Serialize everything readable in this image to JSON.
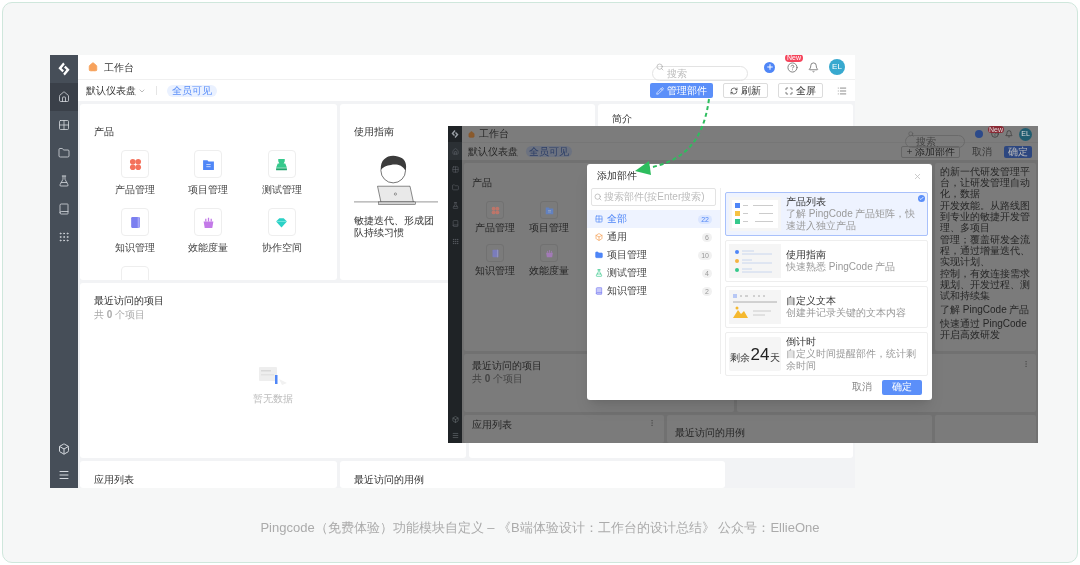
{
  "main": {
    "sidebar": [
      {
        "selected": true
      },
      {
        "selected": false
      },
      {
        "selected": false
      },
      {
        "selected": false
      },
      {
        "selected": false
      },
      {
        "selected": false
      }
    ],
    "header": {
      "title": "工作台",
      "search_placeholder": "搜索",
      "badge": "New",
      "avatar": "EL"
    },
    "toolbar": {
      "dashboard": "默认仪表盘",
      "visibility": "全员可见",
      "buttons": [
        {
          "label": "管理部件",
          "kind": "primary"
        },
        {
          "label": "刷新",
          "kind": "default"
        },
        {
          "label": "全屏",
          "kind": "default"
        }
      ]
    },
    "products": {
      "title": "产品",
      "items": [
        "产品管理",
        "项目管理",
        "测试管理",
        "知识管理",
        "效能度量",
        "协作空间"
      ]
    },
    "guide": {
      "title": "使用指南",
      "caption": "敏捷迭代、形成团队持续习惯"
    },
    "intro": {
      "title": "简介"
    },
    "recent_projects": {
      "title": "最近访问的项目",
      "count": "共 **0** 个项目",
      "empty": "暂无数据"
    },
    "app_list": {
      "title": "应用列表"
    },
    "recent_cases": {
      "title": "最近访问的用例"
    }
  },
  "overlay": {
    "sidebar": [
      {
        "selected": true
      },
      {
        "selected": false
      },
      {
        "selected": false
      },
      {
        "selected": false
      },
      {
        "selected": false
      },
      {
        "selected": false
      }
    ],
    "header": {
      "title": "工作台",
      "search_placeholder": "搜索",
      "badge": "New",
      "avatar": "EL"
    },
    "toolbar": {
      "dashboard": "默认仪表盘",
      "visibility": "全员可见",
      "buttons": [
        {
          "label": "添加部件",
          "kind": "add"
        },
        {
          "label": "取消",
          "kind": "text"
        },
        {
          "label": "确定",
          "kind": "primary"
        }
      ]
    },
    "products": {
      "title": "产品",
      "items": [
        "产品管理",
        "项目管理",
        "知识管理",
        "效能度量"
      ]
    },
    "intro": {
      "lines": [
        "的新一代研发管理平台，让研发管理自动化，数据",
        "开发效能。从路线图到专业的敏捷开发管理、多项目",
        "管理；覆盖研发全流程，通过增量迭代、实现计划、",
        "控制，有效连接需求规划、开发过程、测试和持续集"
      ],
      "links": [
        "了解 PingCode 产品",
        "快速通过 PingCode 开启高效研发"
      ]
    },
    "recent_projects": {
      "title": "最近访问的项目",
      "count": "共 **0** 个项目"
    },
    "app_list": {
      "title": "应用列表"
    },
    "recent_cases": {
      "title": "最近访问的用例"
    },
    "modal": {
      "title": "添加部件",
      "search_placeholder": "搜索部件(按Enter搜索)",
      "categories": [
        {
          "label": "全部",
          "count": "22",
          "selected": true
        },
        {
          "label": "通用",
          "count": "6",
          "selected": false
        },
        {
          "label": "项目管理",
          "count": "10",
          "selected": false
        },
        {
          "label": "测试管理",
          "count": "4",
          "selected": false
        },
        {
          "label": "知识管理",
          "count": "2",
          "selected": false
        }
      ],
      "widgets": [
        {
          "kind": "list",
          "title": "产品列表",
          "description": "了解 PingCode 产品矩阵，快速进入独立产品",
          "selected": true
        },
        {
          "kind": "guide",
          "title": "使用指南",
          "description": "快速熟悉 PingCode 产品",
          "selected": false
        },
        {
          "kind": "text",
          "title": "自定义文本",
          "description": "创建并记录关键的文本内容",
          "selected": false
        },
        {
          "kind": "countdown",
          "title": "倒计时",
          "description": "自定义时间提醒部件，统计剩余时间",
          "selected": false,
          "thumb": {
            "prefix": "剩余",
            "number": "24",
            "unit": "天"
          }
        }
      ],
      "cancel": "取消",
      "confirm": "确定"
    }
  },
  "caption": "Pingcode（免费体验）功能模块自定义 – 《B端体验设计：工作台的设计总结》 公众号：EllieOne"
}
